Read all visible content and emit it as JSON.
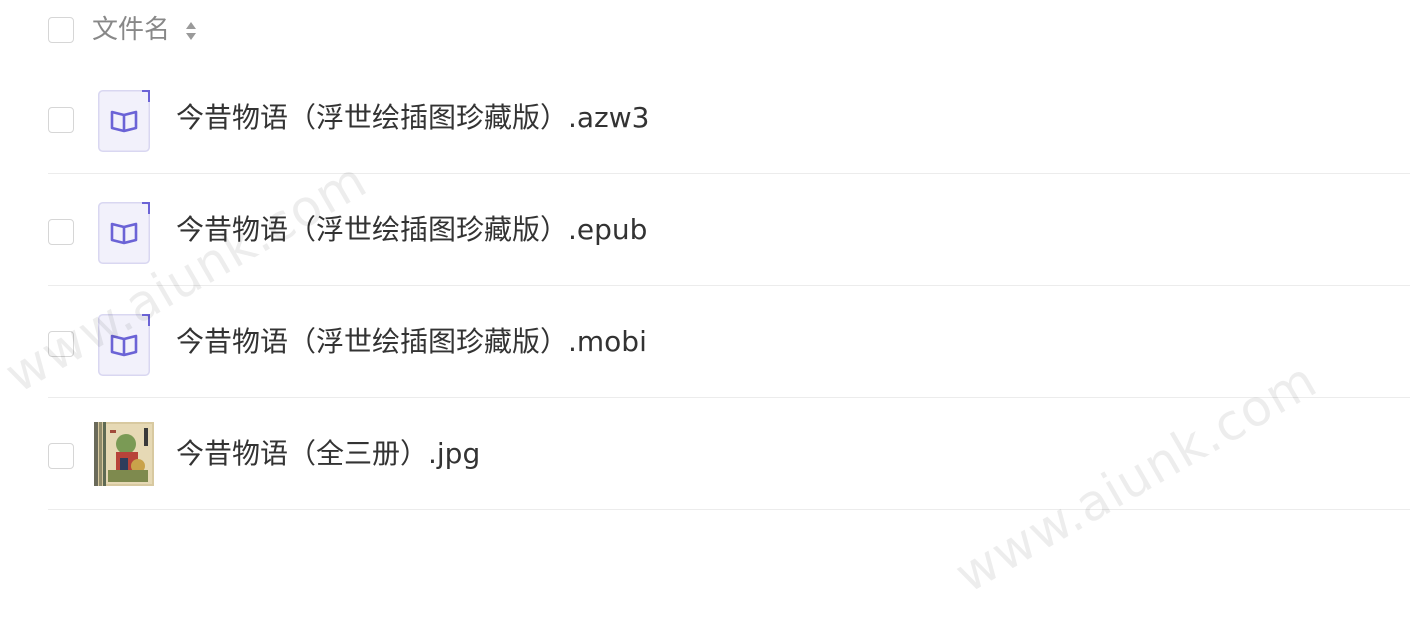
{
  "header": {
    "label": "文件名",
    "sort_icon": "sort-updown-icon"
  },
  "files": [
    {
      "name": "今昔物语（浮世绘插图珍藏版）.azw3",
      "icon": "book-icon"
    },
    {
      "name": "今昔物语（浮世绘插图珍藏版）.epub",
      "icon": "book-icon"
    },
    {
      "name": "今昔物语（浮世绘插图珍藏版）.mobi",
      "icon": "book-icon"
    },
    {
      "name": "今昔物语（全三册）.jpg",
      "icon": "image-thumbnail"
    }
  ],
  "watermark": "www.aiunk.com",
  "colors": {
    "icon_accent": "#6b63d6",
    "icon_bg": "#f2f1fb",
    "checkbox_border": "#d6d6d6",
    "divider": "#ececec"
  }
}
